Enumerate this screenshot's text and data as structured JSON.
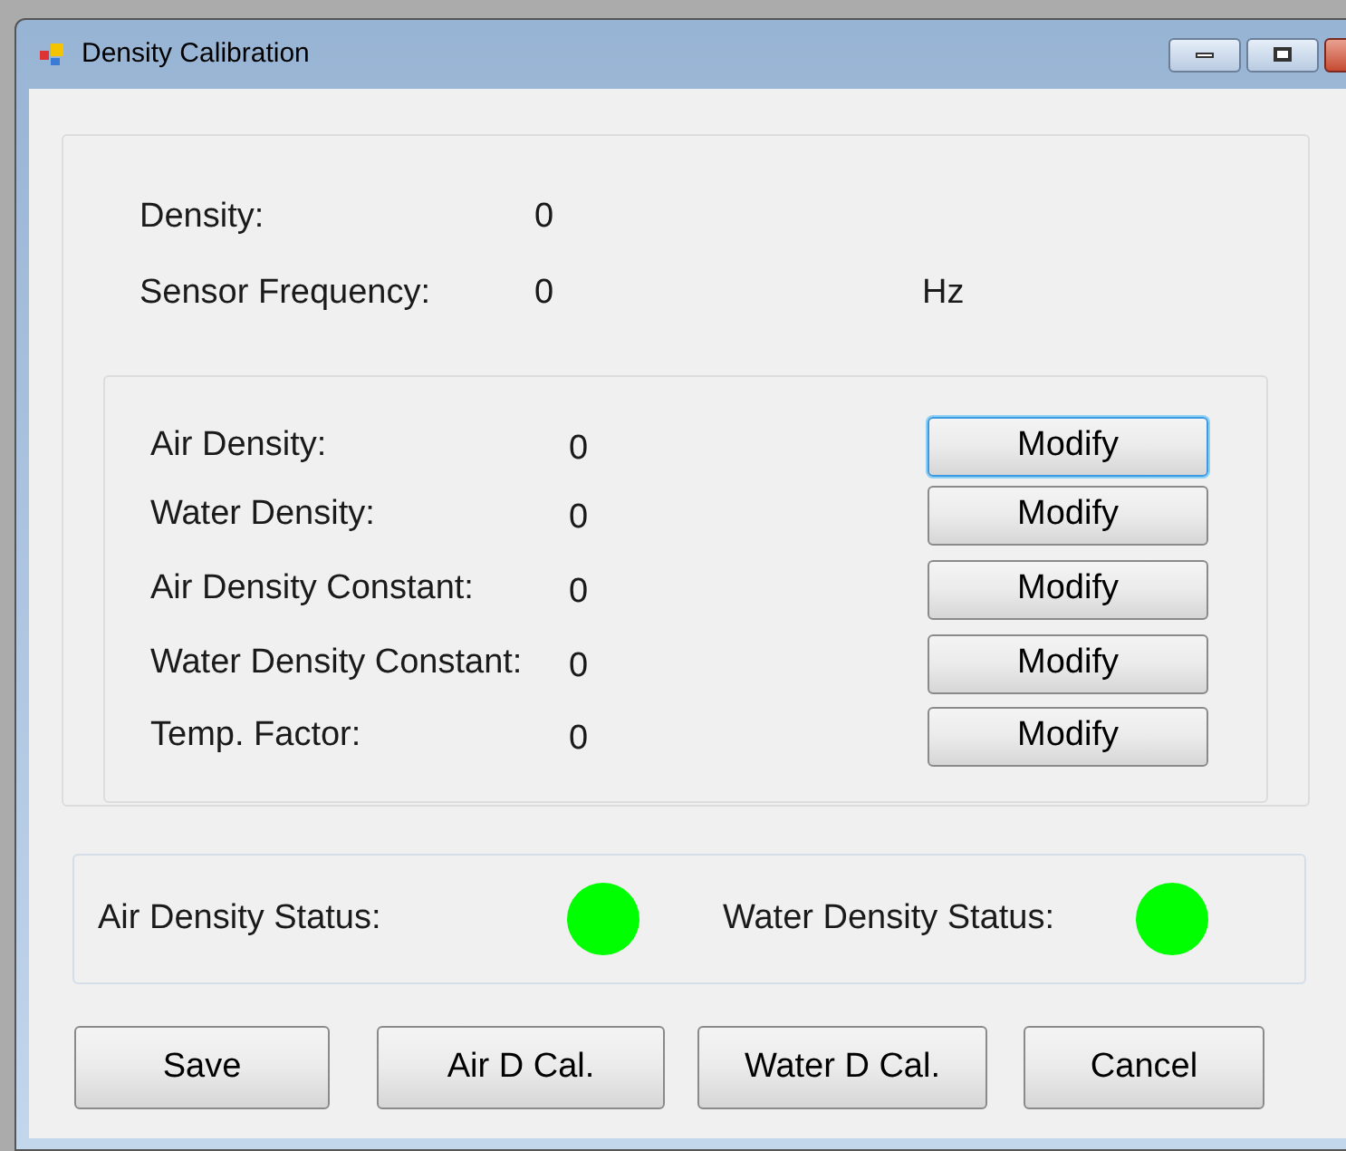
{
  "window": {
    "title": "Density Calibration"
  },
  "readings": [
    {
      "label": "Density:",
      "value": "0"
    },
    {
      "label": "Sensor Frequency:",
      "value": "0",
      "unit": "Hz"
    }
  ],
  "constants": [
    {
      "label": "Air Density:",
      "value": "0",
      "button": "Modify",
      "focused": true
    },
    {
      "label": "Water Density:",
      "value": "0",
      "button": "Modify",
      "focused": false
    },
    {
      "label": "Air Density Constant:",
      "value": "0",
      "button": "Modify",
      "focused": false
    },
    {
      "label": "Water Density Constant:",
      "value": "0",
      "button": "Modify",
      "focused": false
    },
    {
      "label": "Temp. Factor:",
      "value": "0",
      "button": "Modify",
      "focused": false
    }
  ],
  "statuses": [
    {
      "label": "Air Density Status:",
      "color": "#00ff00"
    },
    {
      "label": "Water Density Status:",
      "color": "#00ff00"
    }
  ],
  "buttons": [
    "Save",
    "Air D Cal.",
    "Water D Cal.",
    "Cancel"
  ]
}
